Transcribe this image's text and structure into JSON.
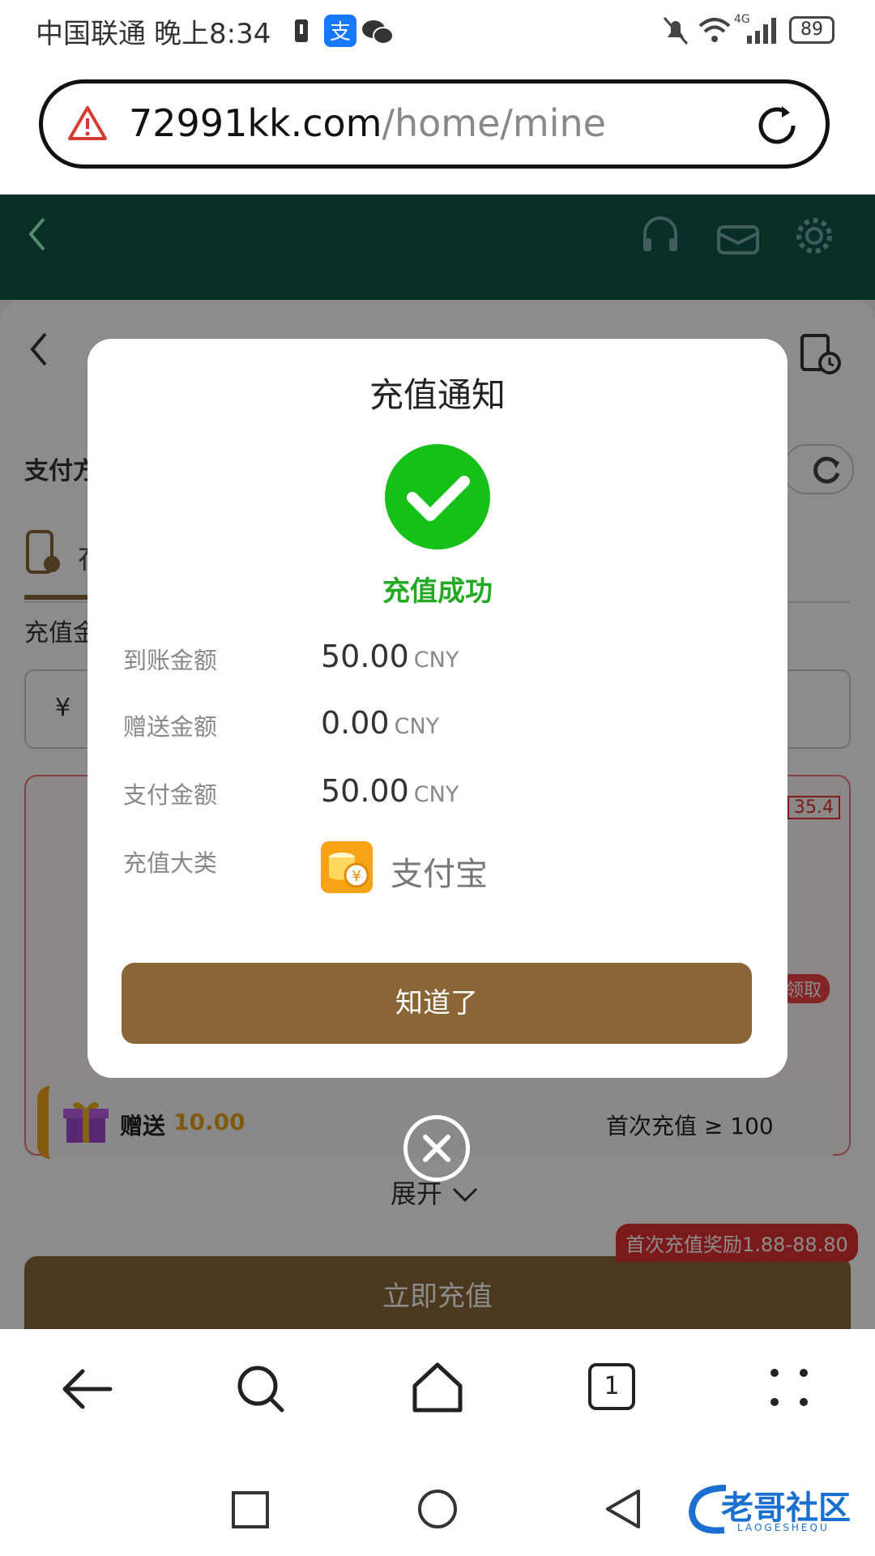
{
  "status_bar": {
    "carrier": "中国联通",
    "time": "晚上8:34",
    "battery": "89",
    "network": "4G"
  },
  "url_bar": {
    "domain": "72991kk.com",
    "path": "/home/mine"
  },
  "page_background": {
    "section_title": "支付方式",
    "tab_label": "在",
    "amount_label": "充值金额",
    "currency_symbol": "¥",
    "rate_badge": "35.4",
    "claim_badge": "领取",
    "gift_row": {
      "prefix": "赠送",
      "amount": "10.00",
      "condition": "首次充值 ≥ 100"
    },
    "expand_label": "展开",
    "promo_badge": "首次充值奖励1.88-88.80",
    "recharge_button": "立即充值"
  },
  "modal": {
    "title": "充值通知",
    "status": "充值成功",
    "rows": [
      {
        "label": "到账金额",
        "value": "50.00",
        "currency": "CNY"
      },
      {
        "label": "赠送金额",
        "value": "0.00",
        "currency": "CNY"
      },
      {
        "label": "支付金额",
        "value": "50.00",
        "currency": "CNY"
      }
    ],
    "category_label": "充值大类",
    "category_value": "支付宝",
    "confirm_button": "知道了"
  },
  "watermark": {
    "text": "老哥社区",
    "sub": "LAOGESHEQU"
  },
  "colors": {
    "header": "#0e5746",
    "accent_brown": "#8a6637",
    "success": "#16c016",
    "alipay_orange": "#f6a415"
  },
  "icons": {
    "status": [
      "battery-icon",
      "alipay-app-icon",
      "wechat-icon",
      "mute-icon",
      "wifi-icon",
      "signal-icon"
    ],
    "browser_nav": [
      "back-arrow-icon",
      "search-icon",
      "home-icon",
      "tabs-icon",
      "menu-dots-icon"
    ],
    "sys_nav": [
      "recent-apps-icon",
      "home-circle-icon",
      "back-triangle-icon"
    ]
  },
  "tab_count": "1"
}
